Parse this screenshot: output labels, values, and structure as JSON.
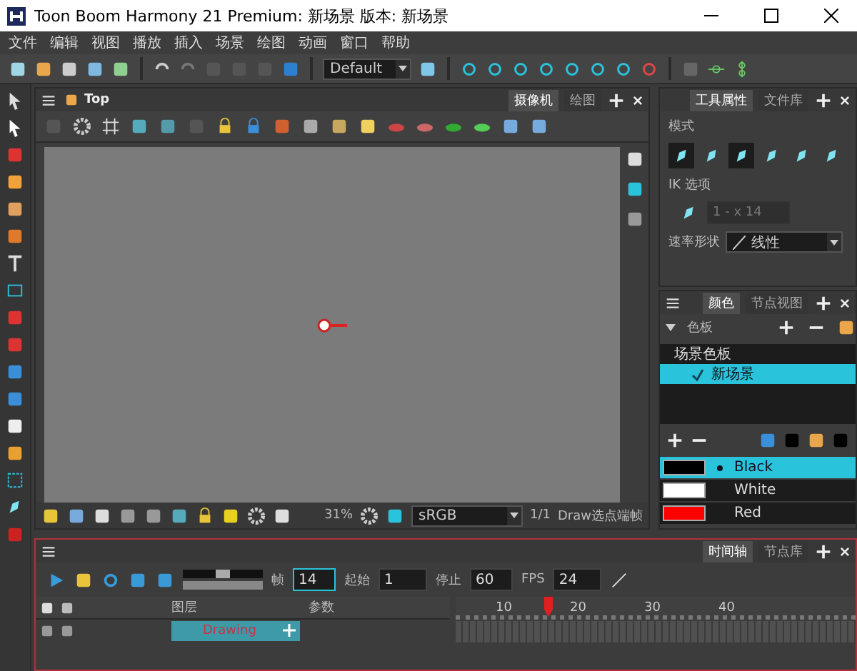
{
  "window": {
    "title": "Toon Boom Harmony 21 Premium: 新场景 版本: 新场景"
  },
  "menu": [
    "文件",
    "编辑",
    "视图",
    "播放",
    "插入",
    "场景",
    "绘图",
    "动画",
    "窗口",
    "帮助"
  ],
  "toolbar": {
    "workspace": "Default"
  },
  "camera_view": {
    "breadcrumb": "Top",
    "tabs": [
      {
        "label": "摄像机",
        "selected": true
      },
      {
        "label": "绘图",
        "selected": false
      }
    ],
    "zoom": "31%",
    "color_space": "sRGB",
    "ratio": "1/1",
    "mode": "Draw选点端帧"
  },
  "tool_properties": {
    "tabs": [
      {
        "label": "工具属性",
        "selected": true
      },
      {
        "label": "文件库",
        "selected": false
      }
    ],
    "mode_label": "模式",
    "mode_tools": [
      {
        "selected": true
      },
      {
        "selected": false
      },
      {
        "selected": true
      },
      {
        "selected": false
      },
      {
        "selected": false
      },
      {
        "selected": false
      }
    ],
    "ik_label": "IK 选项",
    "ik_value": "1 - x 14",
    "ease_label": "速率形状",
    "ease_value": "线性"
  },
  "color": {
    "tabs": [
      {
        "label": "颜色",
        "selected": true
      },
      {
        "label": "节点视图",
        "selected": false
      }
    ],
    "palette_label": "色板",
    "palette_group": "场景色板",
    "palettes": [
      {
        "label": "新场景",
        "selected": true,
        "checked": true
      }
    ],
    "swatches": [
      {
        "name": "Black",
        "color": "#000000",
        "selected": true
      },
      {
        "name": "White",
        "color": "#ffffff",
        "selected": false
      },
      {
        "name": "Red",
        "color": "#ff0000",
        "selected": false
      }
    ]
  },
  "timeline": {
    "speed": {
      "level": 0.5
    },
    "tabs": [
      {
        "label": "时间轴",
        "selected": true
      },
      {
        "label": "节点库",
        "selected": false
      }
    ],
    "frame_label": "帧",
    "frame": "14",
    "start_label": "起始",
    "start": "1",
    "stop_label": "停止",
    "stop": "60",
    "fps_label": "FPS",
    "fps": "24",
    "layers_header": "图层",
    "params_header": "参数",
    "layers": [
      {
        "name": "Drawing",
        "selected": true
      }
    ],
    "ruler": [
      "10",
      "20",
      "30",
      "40"
    ]
  }
}
